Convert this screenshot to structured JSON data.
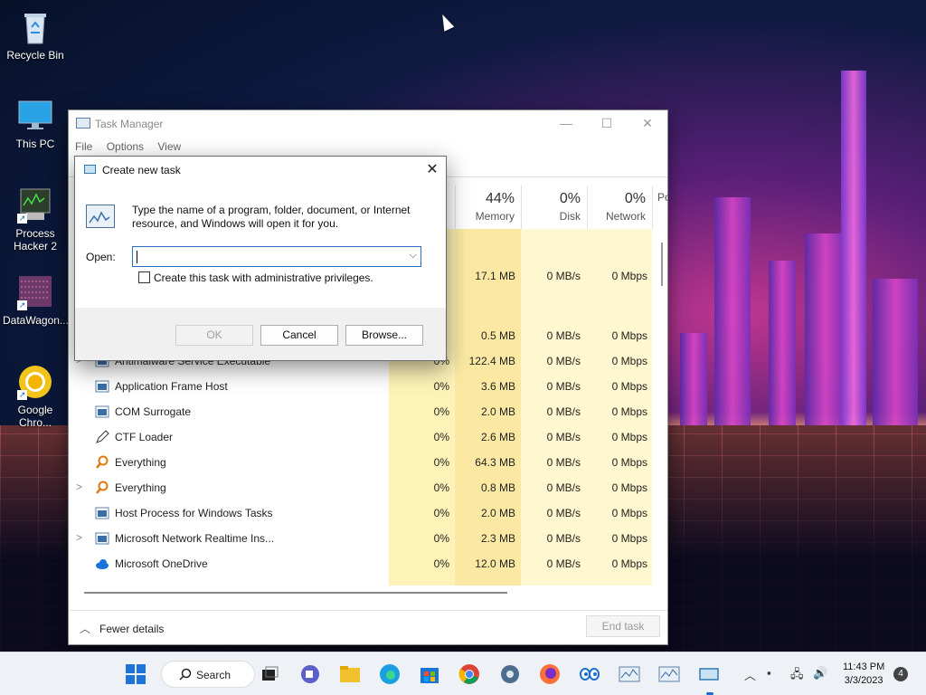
{
  "desktop": {
    "icons": [
      {
        "name": "recycle-bin",
        "label": "Recycle Bin",
        "icon": "recycle-bin-icon"
      },
      {
        "name": "this-pc",
        "label": "This PC",
        "icon": "monitor-icon"
      },
      {
        "name": "process-hacker",
        "label": "Process Hacker 2",
        "icon": "process-hacker-icon"
      },
      {
        "name": "datawagon",
        "label": "DataWagon...",
        "icon": "datawagon-icon"
      },
      {
        "name": "google-chrome",
        "label": "Google Chro...",
        "icon": "chrome-icon"
      }
    ]
  },
  "task_manager": {
    "title": "Task Manager",
    "menu": [
      "File",
      "Options",
      "View"
    ],
    "columns": [
      {
        "pct": "44%",
        "label": "Memory"
      },
      {
        "pct": "0%",
        "label": "Disk"
      },
      {
        "pct": "0%",
        "label": "Network"
      },
      {
        "pct": "",
        "label": "Po"
      }
    ],
    "partial_rows": [
      {
        "memory": "17.1 MB",
        "disk": "0 MB/s",
        "network": "0 Mbps"
      },
      {
        "memory": "0.5 MB",
        "disk": "0 MB/s",
        "network": "0 Mbps"
      }
    ],
    "processes": [
      {
        "name": "Antimalware Service Executable",
        "expand": ">",
        "cpu": "0%",
        "memory": "122.4 MB",
        "disk": "0 MB/s",
        "network": "0 Mbps",
        "icon": "app-window-icon"
      },
      {
        "name": "Application Frame Host",
        "expand": "",
        "cpu": "0%",
        "memory": "3.6 MB",
        "disk": "0 MB/s",
        "network": "0 Mbps",
        "icon": "app-window-icon"
      },
      {
        "name": "COM Surrogate",
        "expand": "",
        "cpu": "0%",
        "memory": "2.0 MB",
        "disk": "0 MB/s",
        "network": "0 Mbps",
        "icon": "app-window-icon"
      },
      {
        "name": "CTF Loader",
        "expand": "",
        "cpu": "0%",
        "memory": "2.6 MB",
        "disk": "0 MB/s",
        "network": "0 Mbps",
        "icon": "pen-icon"
      },
      {
        "name": "Everything",
        "expand": "",
        "cpu": "0%",
        "memory": "64.3 MB",
        "disk": "0 MB/s",
        "network": "0 Mbps",
        "icon": "magnifier-orange-icon"
      },
      {
        "name": "Everything",
        "expand": ">",
        "cpu": "0%",
        "memory": "0.8 MB",
        "disk": "0 MB/s",
        "network": "0 Mbps",
        "icon": "magnifier-orange-icon"
      },
      {
        "name": "Host Process for Windows Tasks",
        "expand": "",
        "cpu": "0%",
        "memory": "2.0 MB",
        "disk": "0 MB/s",
        "network": "0 Mbps",
        "icon": "app-window-icon"
      },
      {
        "name": "Microsoft Network Realtime Ins...",
        "expand": ">",
        "cpu": "0%",
        "memory": "2.3 MB",
        "disk": "0 MB/s",
        "network": "0 Mbps",
        "icon": "app-window-icon"
      },
      {
        "name": "Microsoft OneDrive",
        "expand": "",
        "cpu": "0%",
        "memory": "12.0 MB",
        "disk": "0 MB/s",
        "network": "0 Mbps",
        "icon": "onedrive-cloud-icon"
      }
    ],
    "footer": {
      "fewer_details": "Fewer details",
      "end_task": "End task"
    }
  },
  "dialog": {
    "title": "Create new task",
    "description": "Type the name of a program, folder, document, or Internet resource, and Windows will open it for you.",
    "open_label": "Open:",
    "open_value": "",
    "admin_checkbox_label": "Create this task with administrative privileges.",
    "admin_checked": false,
    "buttons": {
      "ok": "OK",
      "cancel": "Cancel",
      "browse": "Browse..."
    }
  },
  "taskbar": {
    "search_label": "Search",
    "time": "11:43 PM",
    "date": "3/3/2023",
    "notification_count": "4"
  }
}
